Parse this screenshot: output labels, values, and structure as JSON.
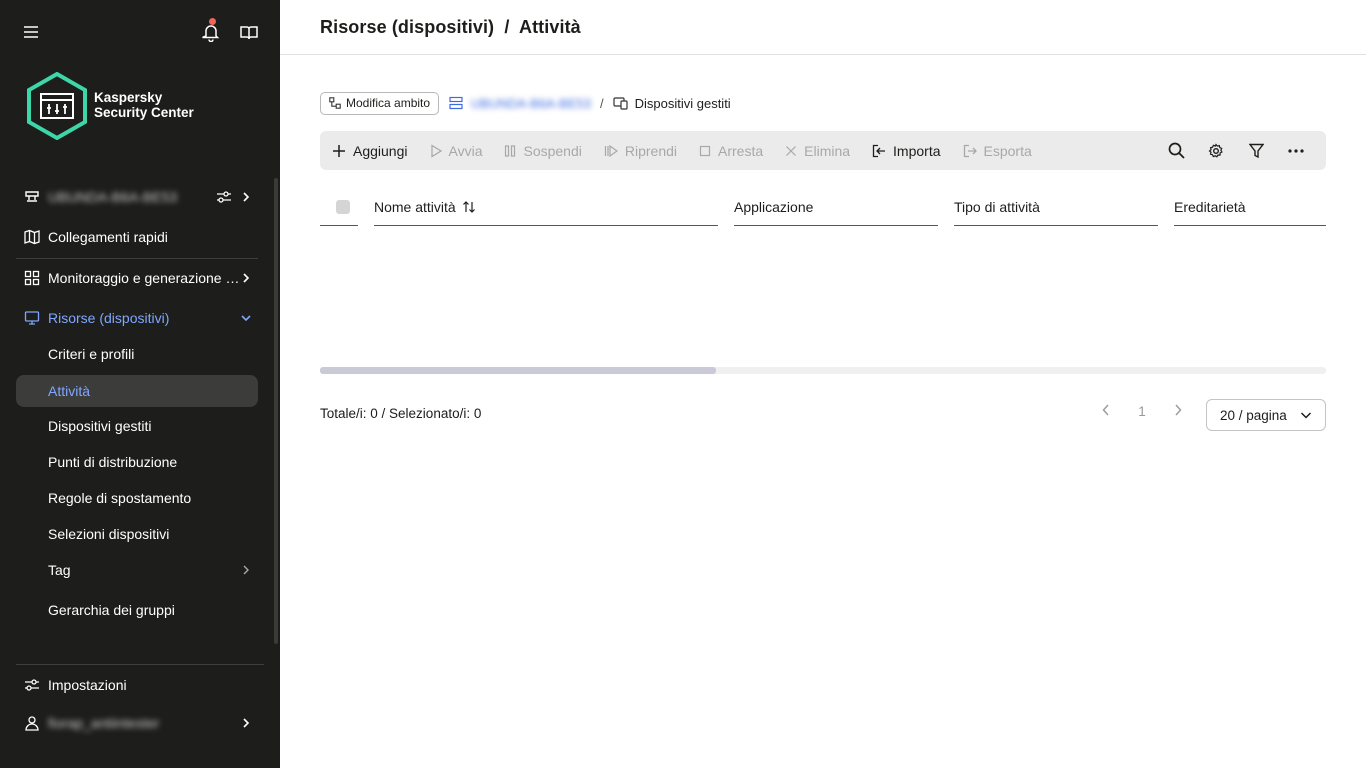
{
  "colors": {
    "sidebar_bg": "#1d1d1b",
    "accent": "#7ea7ff",
    "link": "#3e6ce0",
    "notification": "#f0645a"
  },
  "sidebar": {
    "brand_line1": "Kaspersky",
    "brand_line2": "Security Center",
    "server_item": "UBUNDA-B6A-BE53",
    "items": [
      {
        "label": "Collegamenti rapidi",
        "icon": "map-icon"
      },
      {
        "label": "Monitoraggio e generazione …",
        "icon": "dashboard-icon"
      },
      {
        "label": "Risorse (dispositivi)",
        "icon": "monitor-icon"
      }
    ],
    "subitems": [
      {
        "label": "Criteri e profili"
      },
      {
        "label": "Attività"
      },
      {
        "label": "Dispositivi gestiti"
      },
      {
        "label": "Punti di distribuzione"
      },
      {
        "label": "Regole di spostamento"
      },
      {
        "label": "Selezioni dispositivi"
      },
      {
        "label": "Tag"
      },
      {
        "label": "Gerarchia dei gruppi"
      }
    ],
    "settings_label": "Impostazioni",
    "user_label": "fiorap_antiintester"
  },
  "header": {
    "title": "Risorse (dispositivi)  /  Attività"
  },
  "breadcrumb": {
    "scope_button": "Modifica ambito",
    "server": "UBUNDA-B6A-BE53",
    "current": "Dispositivi gestiti"
  },
  "toolbar": {
    "add": "Aggiungi",
    "start": "Avvia",
    "suspend": "Sospendi",
    "resume": "Riprendi",
    "stop": "Arresta",
    "delete": "Elimina",
    "import": "Importa",
    "export": "Esporta"
  },
  "table": {
    "columns": [
      "Nome attività",
      "Applicazione",
      "Tipo di attività",
      "Ereditarietà"
    ]
  },
  "footer": {
    "total": "Totale/i: 0 / Selezionato/i: 0",
    "current_page": "1",
    "per_page": "20 / pagina"
  }
}
